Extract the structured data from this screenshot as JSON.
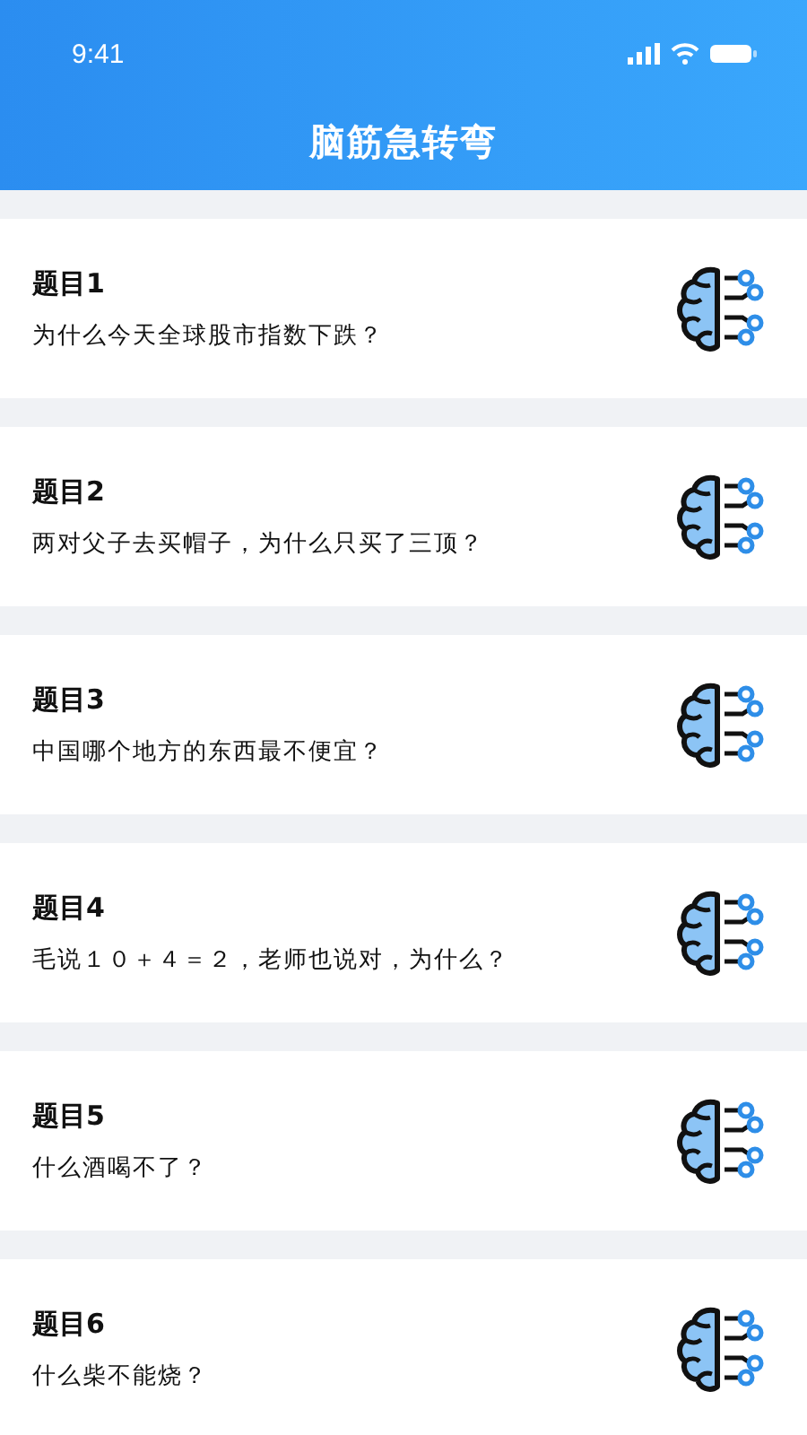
{
  "status_bar": {
    "time": "9:41"
  },
  "header": {
    "title": "脑筋急转弯"
  },
  "questions": [
    {
      "title": "题目1",
      "text": "为什么今天全球股市指数下跌？"
    },
    {
      "title": "题目2",
      "text": "两对父子去买帽子，为什么只买了三顶？"
    },
    {
      "title": "题目3",
      "text": "中国哪个地方的东西最不便宜？"
    },
    {
      "title": "题目4",
      "text": "毛说１０＋４＝２，老师也说对，为什么？"
    },
    {
      "title": "题目5",
      "text": "什么酒喝不了？"
    },
    {
      "title": "题目6",
      "text": "什么柴不能烧？"
    }
  ]
}
